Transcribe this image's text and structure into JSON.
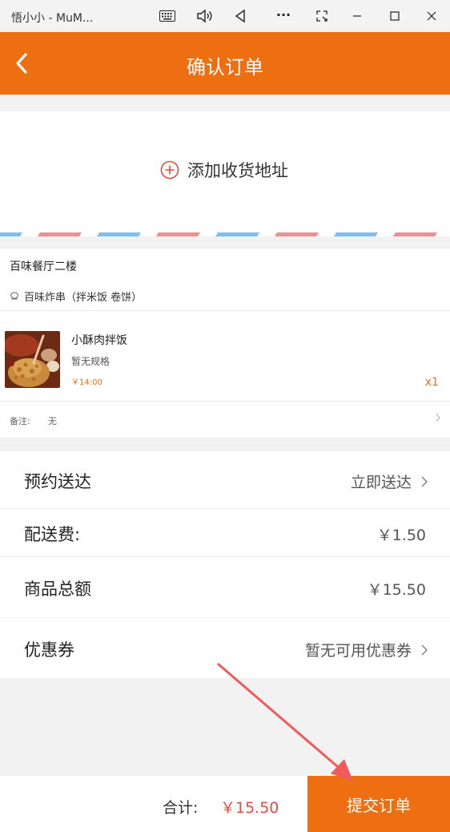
{
  "window": {
    "title": "悟小小 - MuM...",
    "more_label": "···"
  },
  "header": {
    "title": "确认订单"
  },
  "address": {
    "add_label": "添加收货地址"
  },
  "store": {
    "name": "百味餐厅二楼",
    "shop": "百味炸串（拌米饭 卷饼）"
  },
  "item": {
    "name": "小酥肉拌饭",
    "spec": "暂无规格",
    "price": "￥14:00",
    "qty": "x1"
  },
  "note": {
    "label": "备注:",
    "value": "无"
  },
  "rows": {
    "delivery_label": "预约送达",
    "delivery_value": "立即送达",
    "fee_label": "配送费:",
    "fee_value": "￥1.50",
    "goods_label": "商品总额",
    "goods_value": "￥15.50",
    "coupon_label": "优惠券",
    "coupon_value": "暂无可用优惠券"
  },
  "footer": {
    "total_label": "合计:",
    "total_value": "￥15.50",
    "submit_label": "提交订单"
  },
  "colors": {
    "accent": "#ee6f12",
    "price_red": "#e84a3c",
    "stripe_blue": "#7fbfee",
    "stripe_red": "#ef8f8f",
    "arrow_red": "#f05a5a"
  }
}
